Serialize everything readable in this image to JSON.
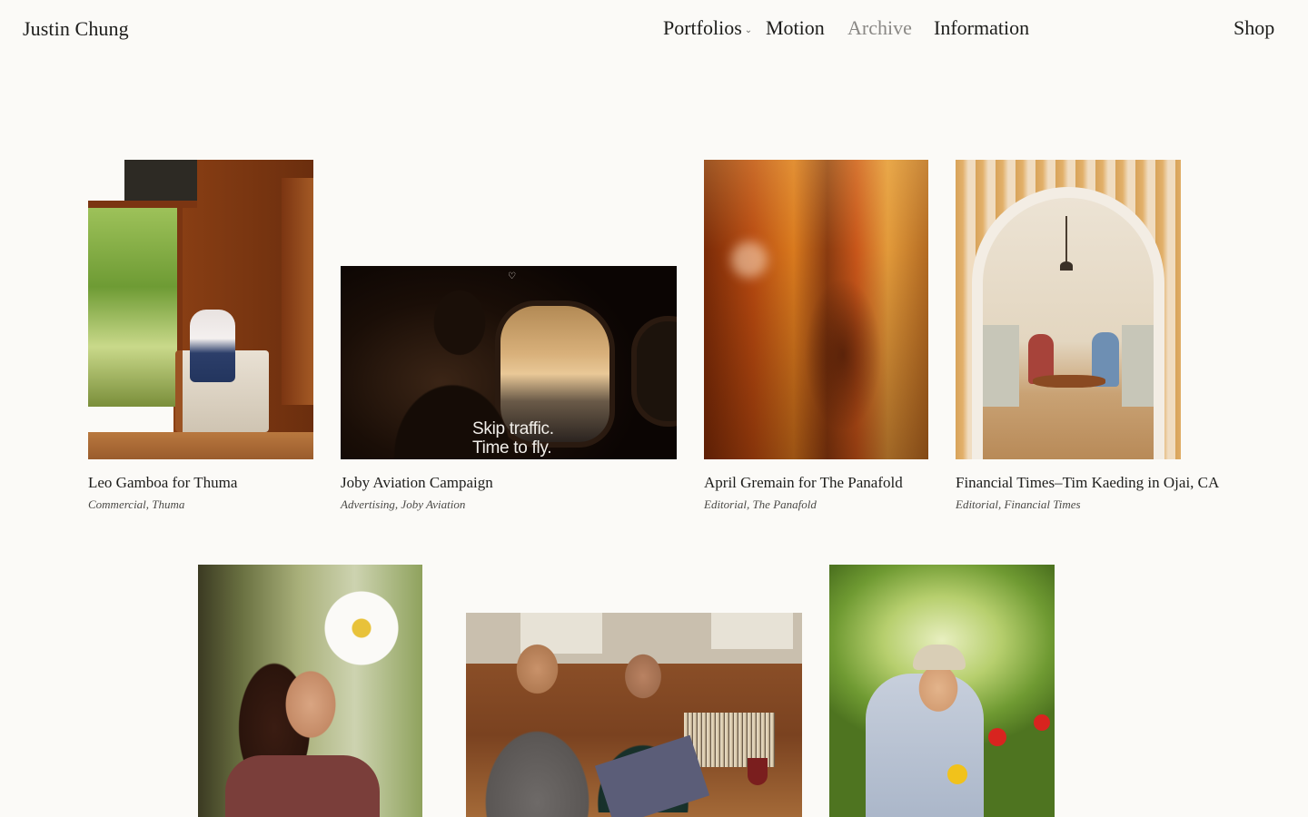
{
  "header": {
    "logo": "Justin Chung",
    "nav": {
      "portfolios": "Portfolios",
      "motion": "Motion",
      "archive": "Archive",
      "information": "Information",
      "shop": "Shop"
    }
  },
  "grid": {
    "row1": [
      {
        "title": "Leo Gamboa for Thuma",
        "meta": "Commercial, Thuma"
      },
      {
        "title": "Joby Aviation Campaign",
        "meta": "Advertising, Joby Aviation",
        "overlay": "Skip traffic.\nTime to fly."
      },
      {
        "title": "April Gremain for The Panafold",
        "meta": "Editorial, The Panafold"
      },
      {
        "title": "Financial Times–Tim Kaeding in Ojai, CA",
        "meta": "Editorial, Financial Times"
      }
    ]
  },
  "colors": {
    "background": "#fbfaf7",
    "text": "#1d1d1b",
    "active_nav": "#8a8885"
  }
}
